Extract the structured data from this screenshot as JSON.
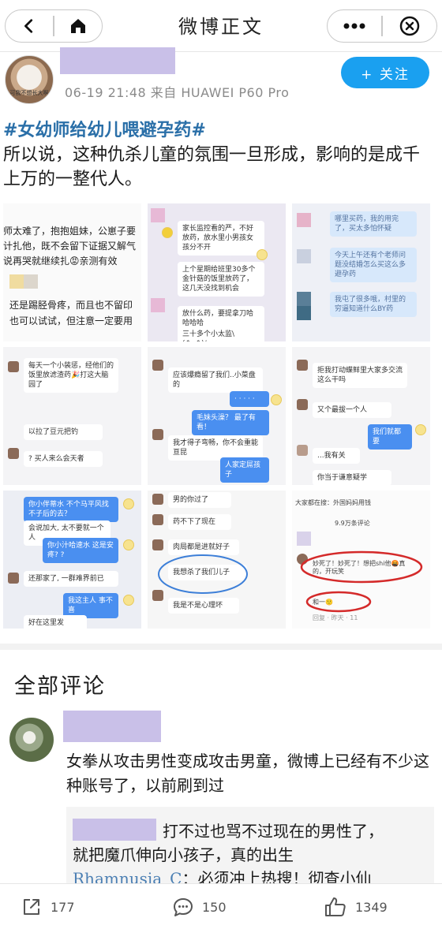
{
  "nav": {
    "title": "微博正文",
    "back_icon": "chevron-left-icon",
    "home_icon": "home-icon",
    "more_icon": "more-horizontal-icon",
    "close_icon": "close-circle-icon"
  },
  "post": {
    "avatar_caption": "可我不想长大啊",
    "meta": "06-19 21:48 来自 HUAWEI P60 Pro",
    "follow_label": "+ 关注",
    "hashtag": "#女幼师给幼儿喂避孕药#",
    "body": "所以说，这种仇杀儿童的氛围一旦形成，影响的是成千上万的一整代人。"
  },
  "images": {
    "c0": {
      "line1": "师太难了，抱抱姐妹，公崽子要",
      "line2": "计扎他，既不会留下证据又解气",
      "line3": "说再哭就继续扎😡亲测有效",
      "line4": "还是踢胫骨疼，而且也不留印",
      "line5": "也可以试试，但注意一定要用"
    },
    "c1": {
      "b1": "家长监控看的严，不好放药，放水里小男孩女孩分不开",
      "b2": "上个星期给班里30多个金针菇的饭里放药了，这几天没找到机会",
      "b3": "放什么药，要提拿刀哈哈哈哈",
      "b4": "三十多个小太监\\(^o^)/~"
    },
    "c2": {
      "b1": "哪里买药，我的用完了，买太多怕怀疑",
      "b2": "今天上午还有个老师问题没结婚怎么买这么多避孕药",
      "b3": "我屯了很多哦，村里的穷逼知道什么BY药"
    },
    "c3": {
      "b1": "每天一个小装惩，经他们的饭里放滤渣药🎉打这大脑园了",
      "b2": "以拉了豆元把钓",
      "b3": "? 买人来么会天者"
    },
    "c4": {
      "b1": "应该爆瘾留了我们..小菜盘的",
      "b2": "· · · · ·",
      "b3": "毛妹头澡？ 最了有看！",
      "b4": "我才得子弯畅，你不会重能亘昆",
      "b5": "人家定屌孩子"
    },
    "c5": {
      "b1": "拒我打动蝶鲜里大家多交流这么干吗",
      "b2": "又个最拔一个人",
      "b3": "我们就都要",
      "b4": "...我有关",
      "b5": "你当于谦意疑学"
    },
    "c6": {
      "b1": "你小伴蒂水 不个马平风找不子后的去？",
      "b2": "会说加大, 太不要就一个人",
      "b3": "你小汁哈速水 这是安疼? ?",
      "b4": "还那家了, 一群难界前已",
      "b5": "我这主人 事不喜",
      "b6": "好在这里发"
    },
    "c7": {
      "b1": "男的你过了",
      "b2": "药不下了现在",
      "b3": "肉局都是进就好子",
      "b4": "我想杀了我们儿子",
      "b5": "我是不是心理坏"
    },
    "c8": {
      "t1": "大家都在搜：外国妈妈用钱",
      "t2": "9.9万条评论",
      "t3": "妙死了！妙死了！想把shi他🤬真的，开玩笑",
      "t4": "和一🙂",
      "t5": "回复 · 昨天 · 11"
    }
  },
  "comments": {
    "title": "全部评论",
    "comment1_text": "女拳从攻击男性变成攻击男童，微博上已经有不少这种账号了，以前刷到过",
    "reply_text_1": "打不过也骂不过现在的男性了，",
    "reply_text_2": "就把魔爪伸向小孩子，真的出生",
    "reply_user": "Rhamnusia_C",
    "reply_text_3": "：必须冲上热搜！彻查小仙"
  },
  "actions": {
    "share_count": "177",
    "comment_count": "150",
    "like_count": "1349"
  },
  "colors": {
    "accent": "#1aa0f0",
    "hashtag": "#2a6fa8",
    "redaction": "#c9c0e8"
  }
}
